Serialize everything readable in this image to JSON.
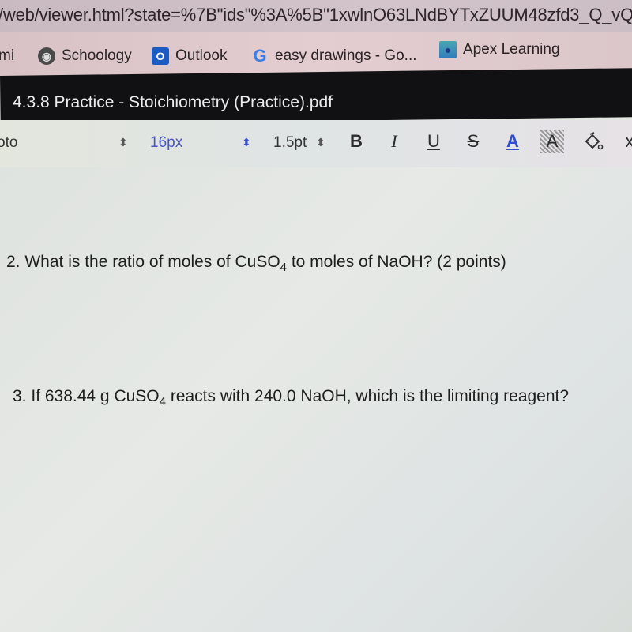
{
  "browser": {
    "url": "/web/viewer.html?state=%7B\"ids\"%3A%5B\"1xwlnO63LNdBYTxZUUM48zfd3_Q_vQ",
    "bookmarks": [
      {
        "label": "mi",
        "icon": "partial-bookmark"
      },
      {
        "label": "Schoology",
        "icon": "schoology-icon"
      },
      {
        "label": "Outlook",
        "icon": "outlook-icon"
      },
      {
        "label": "easy drawings - Go...",
        "icon": "google-icon"
      },
      {
        "label": "Apex Learning",
        "icon": "apex-learning-icon"
      }
    ]
  },
  "viewer": {
    "title": "4.3.8 Practice - Stoichiometry (Practice).pdf"
  },
  "toolbar": {
    "font_family": "oto",
    "font_size": "16px",
    "line_width": "1.5pt",
    "bold": "B",
    "italic": "I",
    "underline": "U",
    "strikethrough": "S",
    "text_color": "A",
    "highlight": "A",
    "fill": "paint-bucket",
    "close": "x",
    "accent_color": "#3a4fd0"
  },
  "document": {
    "questions": [
      {
        "number": "2.",
        "before": "What is the ratio of moles of CuSO",
        "sub": "4",
        "after": " to moles of NaOH? (2 points)"
      },
      {
        "number": "3.",
        "before": "If 638.44 g CuSO",
        "sub": "4",
        "after": " reacts with 240.0 NaOH, which is the limiting reagent?"
      }
    ]
  }
}
